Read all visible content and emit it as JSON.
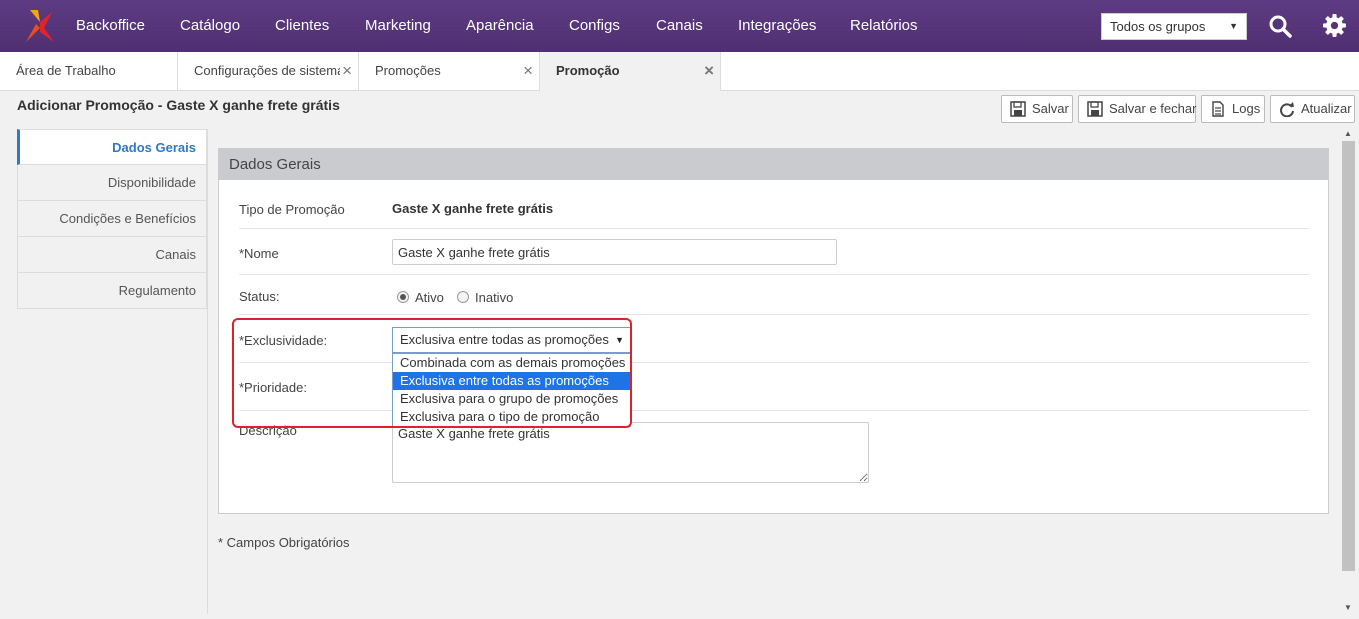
{
  "nav": {
    "items": [
      "Backoffice",
      "Catálogo",
      "Clientes",
      "Marketing",
      "Aparência",
      "Configs",
      "Canais",
      "Integrações",
      "Relatórios"
    ],
    "group_select": "Todos os grupos"
  },
  "tabs": [
    {
      "label": "Área de Trabalho",
      "closable": false
    },
    {
      "label": "Configurações de sistema",
      "closable": true
    },
    {
      "label": "Promoções",
      "closable": true
    },
    {
      "label": "Promoção",
      "closable": true,
      "active": true
    }
  ],
  "tab_close_glyph": "×",
  "page": {
    "title": "Adicionar Promoção - Gaste X ganhe frete grátis"
  },
  "toolbar": {
    "save": "Salvar",
    "save_close": "Salvar e fechar",
    "logs": "Logs",
    "refresh": "Atualizar"
  },
  "sidemenu": [
    "Dados Gerais",
    "Disponibilidade",
    "Condições e Benefícios",
    "Canais",
    "Regulamento"
  ],
  "panel": {
    "title": "Dados Gerais",
    "tipo_label": "Tipo de Promoção",
    "tipo_value": "Gaste X ganhe frete grátis",
    "nome_label": "*Nome",
    "nome_value": "Gaste X ganhe frete grátis",
    "status_label": "Status:",
    "status_options": [
      "Ativo",
      "Inativo"
    ],
    "status_selected": "Ativo",
    "exclusividade_label": "*Exclusividade:",
    "exclusividade_value": "Exclusiva entre todas as promoções",
    "exclusividade_options": [
      "Combinada com as demais promoções",
      "Exclusiva entre todas as promoções",
      "Exclusiva para o grupo de promoções",
      "Exclusiva para o tipo de promoção"
    ],
    "prioridade_label": "*Prioridade:",
    "descricao_label": "Descrição",
    "descricao_value": "Gaste X ganhe frete grátis"
  },
  "required_note": "* Campos Obrigatórios",
  "colors": {
    "nav_bg": "#5a3a7e",
    "accent": "#3079c4",
    "highlight": "#d9232d",
    "selected_option": "#1e73e6"
  },
  "icons": [
    "logo-icon",
    "search-icon",
    "gear-icon",
    "save-icon",
    "logs-icon",
    "refresh-icon",
    "close-icon",
    "chevron-down-icon"
  ]
}
